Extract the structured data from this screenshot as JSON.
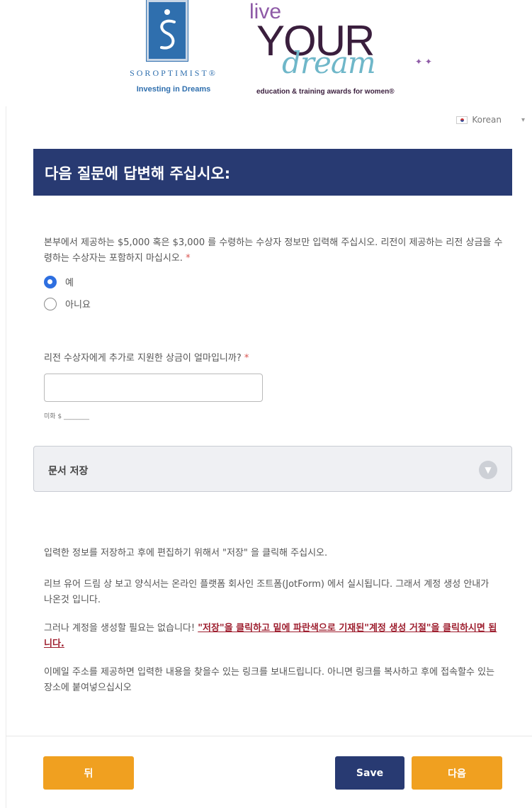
{
  "header": {
    "soroptimist_name": "SOROPTIMIST®",
    "soroptimist_tagline": "Investing in Dreams",
    "lyd_live": "live",
    "lyd_your": "YOUR",
    "lyd_dream": "dream",
    "lyd_tagline": "education & training awards for women®"
  },
  "language": {
    "selected": "Korean"
  },
  "section": {
    "title": "다음 질문에 답변해 주십시오:"
  },
  "question1": {
    "text": "본부에서 제공하는 $5,000 혹은 $3,000 를 수령하는 수상자 정보만 입력해 주십시오. 리전이 제공하는 리전 상금을 수령하는 수상자는 포함하지 마십시오.",
    "required_mark": "*",
    "options": [
      {
        "label": "예",
        "checked": true
      },
      {
        "label": "아니요",
        "checked": false
      }
    ]
  },
  "question2": {
    "text": "리전 수상자에게 추가로 지원한 상금이 얼마입니까?",
    "required_mark": "*",
    "value": "",
    "sublabel": "미화 $ ________"
  },
  "save_section": {
    "title": "문서 저장"
  },
  "info": {
    "p1": "입력한 정보를 저장하고 후에 편집하기 위해서 \"저장\" 을 클릭해 주십시오.",
    "p2": "리브 유어 드림 상 보고 양식서는 온라인 플랫폼 회사인 조트폼(JotForm) 에서 실시됩니다. 그래서 계정 생성 안내가 나온것 입니다.",
    "p3_prefix": "그러나 계정을 생성할 필요는 없습니다! ",
    "p3_link": "\"저장\"을 클릭하고 밑에 파란색으로 기재된\"계정 생성 거절\"을 클릭하시면 됩니다.",
    "p4": "이메일 주소를 제공하면 입력한 내용을 찾을수 있는 링크를 보내드립니다. 아니면 링크를 복사하고 후에 접속할수 있는 장소에 붙여넣으십시오"
  },
  "buttons": {
    "back": "뒤",
    "save": "Save",
    "next": "다음"
  }
}
